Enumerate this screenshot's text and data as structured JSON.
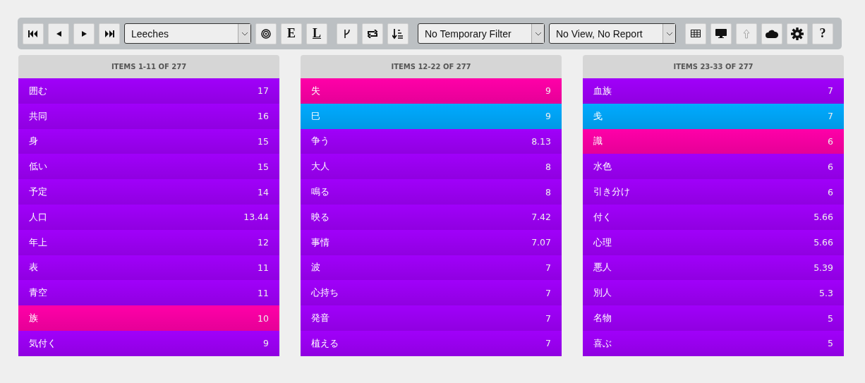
{
  "toolbar": {
    "record_select": {
      "value": "Leeches"
    },
    "format_buttons": [
      "E",
      "L"
    ],
    "filter_select": {
      "value": "No Temporary Filter"
    },
    "view_select": {
      "value": "No View, No Report"
    },
    "upload_button": {
      "disabled": true
    },
    "help_button": "?"
  },
  "columns": [
    {
      "title": "ITEMS 1-11 OF 277",
      "items": [
        {
          "word": "囲む",
          "score": "17",
          "color": "#a000fa"
        },
        {
          "word": "共同",
          "score": "16",
          "color": "#a000fa"
        },
        {
          "word": "身",
          "score": "15",
          "color": "#a000fa"
        },
        {
          "word": "低い",
          "score": "15",
          "color": "#a000fa"
        },
        {
          "word": "予定",
          "score": "14",
          "color": "#a000fa"
        },
        {
          "word": "人口",
          "score": "13.44",
          "color": "#a000fa"
        },
        {
          "word": "年上",
          "score": "12",
          "color": "#a000fa"
        },
        {
          "word": "表",
          "score": "11",
          "color": "#a000fa"
        },
        {
          "word": "青空",
          "score": "11",
          "color": "#a000fa"
        },
        {
          "word": "族",
          "score": "10",
          "color": "#ff00a8"
        },
        {
          "word": "気付く",
          "score": "9",
          "color": "#a000fa"
        }
      ]
    },
    {
      "title": "ITEMS 12-22 OF 277",
      "items": [
        {
          "word": "失",
          "score": "9",
          "color": "#ff00a8"
        },
        {
          "word": "巳",
          "score": "9",
          "color": "#00aaff"
        },
        {
          "word": "争う",
          "score": "8.13",
          "color": "#a000fa"
        },
        {
          "word": "大人",
          "score": "8",
          "color": "#a000fa"
        },
        {
          "word": "鳴る",
          "score": "8",
          "color": "#a000fa"
        },
        {
          "word": "映る",
          "score": "7.42",
          "color": "#a000fa"
        },
        {
          "word": "事情",
          "score": "7.07",
          "color": "#a000fa"
        },
        {
          "word": "波",
          "score": "7",
          "color": "#a000fa"
        },
        {
          "word": "心持ち",
          "score": "7",
          "color": "#a000fa"
        },
        {
          "word": "発音",
          "score": "7",
          "color": "#a000fa"
        },
        {
          "word": "植える",
          "score": "7",
          "color": "#a000fa"
        }
      ]
    },
    {
      "title": "ITEMS 23-33 OF 277",
      "items": [
        {
          "word": "血族",
          "score": "7",
          "color": "#a000fa"
        },
        {
          "word": "戋",
          "score": "7",
          "color": "#00aaff"
        },
        {
          "word": "識",
          "score": "6",
          "color": "#ff00a8"
        },
        {
          "word": "水色",
          "score": "6",
          "color": "#a000fa"
        },
        {
          "word": "引き分け",
          "score": "6",
          "color": "#a000fa"
        },
        {
          "word": "付く",
          "score": "5.66",
          "color": "#a000fa"
        },
        {
          "word": "心理",
          "score": "5.66",
          "color": "#a000fa"
        },
        {
          "word": "悪人",
          "score": "5.39",
          "color": "#a000fa"
        },
        {
          "word": "別人",
          "score": "5.3",
          "color": "#a000fa"
        },
        {
          "word": "名物",
          "score": "5",
          "color": "#a000fa"
        },
        {
          "word": "喜ぶ",
          "score": "5",
          "color": "#a000fa"
        }
      ]
    }
  ]
}
